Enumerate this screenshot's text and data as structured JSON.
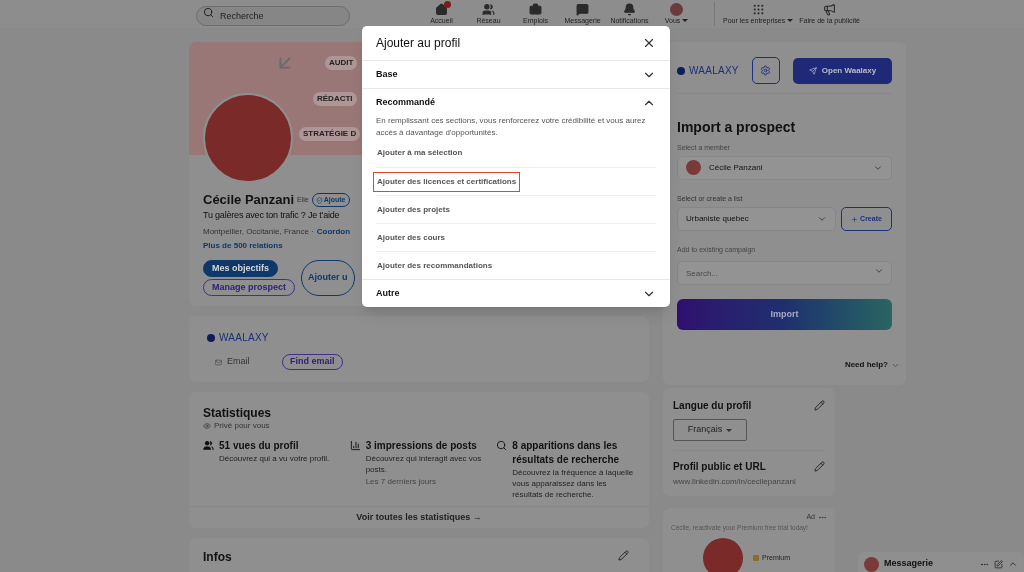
{
  "nav": {
    "search_placeholder": "Recherche",
    "items": [
      {
        "label": "Accueil",
        "notification": true,
        "dropdown": false
      },
      {
        "label": "Réseau",
        "notification": false,
        "dropdown": false
      },
      {
        "label": "Emplois",
        "notification": false,
        "dropdown": false
      },
      {
        "label": "Messagerie",
        "notification": false,
        "dropdown": false
      },
      {
        "label": "Notifications",
        "notification": false,
        "dropdown": false
      },
      {
        "label": "Vous",
        "notification": false,
        "dropdown": true
      }
    ],
    "business": [
      {
        "label": "Pour les entreprises",
        "dropdown": true
      },
      {
        "label": "Faire de la publicité",
        "dropdown": false
      }
    ]
  },
  "profile": {
    "banner_tags": [
      "AUDIT",
      "RÉDACTI",
      "STRATÉGIE D"
    ],
    "name": "Cécile Panzani",
    "pronoun": "Elle",
    "verify": "Ajoute",
    "headline": "Tu galères avec ton trafic ? Je t'aide",
    "location": "Montpellier, Occitanie, France ·",
    "contact": "Coordon",
    "connections": "Plus de 500 relations",
    "buttons": [
      {
        "label": "Mes objectifs",
        "kind": "primary"
      },
      {
        "label": "Manage prospect",
        "kind": "purple"
      },
      {
        "label": "Ajouter u",
        "kind": "outline"
      }
    ]
  },
  "waalaxy_card": {
    "logo": "WAALAXY",
    "email_label": "Email",
    "find_email": "Find email"
  },
  "stats": {
    "title": "Statistiques",
    "privacy": "Privé pour vous",
    "items": [
      {
        "title": "51 vues du profil",
        "description": "Découvrez qui a vu votre profil."
      },
      {
        "title": "3 impressions de posts",
        "description": "Découvrez qui interagit avec vos posts.",
        "note": "Les 7 derniers jours"
      },
      {
        "title": "8 apparitions dans les résultats de recherche",
        "description": "Découvrez la fréquence à laquelle vous apparaissez dans les résultats de recherche."
      }
    ],
    "footer": "Voir toutes les statistiques →"
  },
  "infos": {
    "title": "Infos"
  },
  "modal": {
    "title": "Ajouter au profil",
    "sections": [
      {
        "label": "Base",
        "expanded": false
      },
      {
        "label": "Recommandé",
        "expanded": true,
        "description": "En remplissant ces sections, vous renforcerez votre crédibilité et vous aurez accès à davantage d'opportunités.",
        "items": [
          {
            "label": "Ajouter à ma sélection",
            "highlighted": false
          },
          {
            "label": "Ajouter des licences et certifications",
            "highlighted": true
          },
          {
            "label": "Ajouter des projets",
            "highlighted": false
          },
          {
            "label": "Ajouter des cours",
            "highlighted": false
          },
          {
            "label": "Ajouter des recommandations",
            "highlighted": false
          }
        ]
      },
      {
        "label": "Autre",
        "expanded": false
      }
    ]
  },
  "waalaxy_panel": {
    "logo": "WAALAXY",
    "open_button": "Open Waalaxy",
    "title": "Import a prospect",
    "member_label": "Select a member",
    "member": "Cécile Panzani",
    "list_label": "Select or create a list",
    "list": "Urbaniste quebec",
    "create": "Create",
    "campaign_label": "Add to existing campaign",
    "campaign_placeholder": "Search...",
    "import": "Import",
    "help": "Need help?"
  },
  "language": {
    "title": "Langue du profil",
    "value": "Français"
  },
  "public_profile": {
    "title": "Profil public et URL",
    "url": "www.linkedin.com/in/cecilepanzani"
  },
  "ad": {
    "label": "Ad",
    "text": "Cécile, reactivate your Premium free trial today!",
    "premium": "Premium"
  },
  "messaging": {
    "title": "Messagerie"
  }
}
